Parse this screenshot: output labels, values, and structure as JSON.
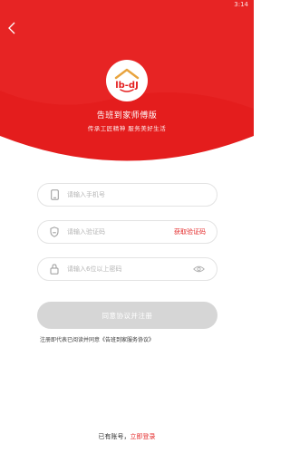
{
  "status_bar": {
    "time": "3:14"
  },
  "header": {
    "logo_text": "lb-dJ",
    "title": "告班到家师傅版",
    "slogan": "传承工匠精神  服务美好生活"
  },
  "form": {
    "phone": {
      "placeholder": "请输入手机号",
      "value": ""
    },
    "code": {
      "placeholder": "请输入验证码",
      "value": "",
      "get_code_label": "获取验证码"
    },
    "password": {
      "placeholder": "请输入6位以上密码",
      "value": ""
    },
    "submit_label": "同意协议并注册"
  },
  "agreement": {
    "prefix": "注册即代表已阅读并同意",
    "link": "《告班到家服务协议》"
  },
  "footer": {
    "prefix": "已有账号，",
    "login_link": "立即登录"
  },
  "colors": {
    "brand_red": "#e41d1d",
    "button_disabled": "#d6d6d6",
    "link_red": "#e42a2a"
  },
  "icons": [
    "back-arrow-icon",
    "phone-icon",
    "shield-icon",
    "lock-icon",
    "eye-icon"
  ]
}
